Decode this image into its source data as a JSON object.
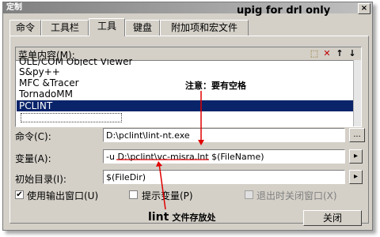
{
  "window": {
    "title": "定制",
    "close": "×"
  },
  "tabs": [
    {
      "label": "命令"
    },
    {
      "label": "工具栏"
    },
    {
      "label": "工具"
    },
    {
      "label": "键盘"
    },
    {
      "label": "附加项和宏文件"
    }
  ],
  "menu_contents": {
    "label": "菜单内容(M):",
    "items": [
      "OLE/COM Object Viewer",
      "S&py++",
      "MFC &Tracer",
      "TornadoMM",
      "PCLINT"
    ],
    "selected": "PCLINT"
  },
  "toolbar_icons": [
    "new-item-icon",
    "delete-icon",
    "up-arrow-icon",
    "down-arrow-icon"
  ],
  "toolbar_glyphs": {
    "new": "⬚",
    "delete": "✕",
    "up": "↑",
    "down": "↓"
  },
  "command": {
    "label": "命令(C):",
    "value": "D:\\pclint\\lint-nt.exe",
    "browse": "..."
  },
  "arguments": {
    "label": "变量(A):",
    "value": "-u D:\\pclint\\vc-misra.lnt $(FileName)",
    "more": "▸"
  },
  "init_dir": {
    "label": "初始目录(I):",
    "value": "$(FileDir)",
    "more": "▸"
  },
  "checks": {
    "use_output": {
      "label": "使用输出窗口(U)",
      "checked": true,
      "mark": "✔"
    },
    "prompt_args": {
      "label": "提示变量(P)",
      "checked": false
    },
    "close_on_exit": {
      "label": "退出时关闭窗口(X)",
      "checked": false
    }
  },
  "close_button": "关闭",
  "annotations": {
    "top": "upig for drl only",
    "note": "注意：要有空格",
    "lint_dir_a": "lint",
    "lint_dir_b": "文件存放处"
  },
  "colors": {
    "annotation_red": "#e00000",
    "selection": "#0a246a",
    "face": "#d4d0c8"
  }
}
